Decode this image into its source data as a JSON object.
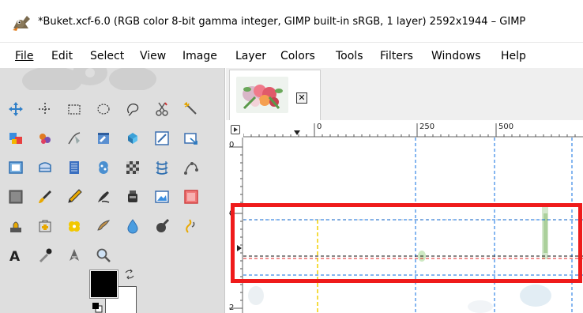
{
  "window": {
    "title": "*Buket.xcf-6.0 (RGB color 8-bit gamma integer, GIMP built-in sRGB, 1 layer) 2592x1944 – GIMP"
  },
  "menubar": {
    "items": [
      {
        "label": "File"
      },
      {
        "label": "Edit"
      },
      {
        "label": "Select"
      },
      {
        "label": "View"
      },
      {
        "label": "Image"
      },
      {
        "label": "Layer"
      },
      {
        "label": "Colors"
      },
      {
        "label": "Tools"
      },
      {
        "label": "Filters"
      },
      {
        "label": "Windows"
      },
      {
        "label": "Help"
      }
    ]
  },
  "toolbox": {
    "tools": [
      "move-icon",
      "alignment-icon",
      "rect-select-icon",
      "ellipse-select-icon",
      "free-select-icon",
      "scissors-select-icon",
      "fuzzy-select-icon",
      "foreground-select-icon",
      "by-color-select-icon",
      "paths-icon",
      "color-picker-icon",
      "zoom-icon",
      "measure-icon",
      "text-tool-icon",
      "crop-icon",
      "unified-transform-icon",
      "perspective-icon",
      "flip-icon",
      "cage-icon",
      "warp-transform-icon",
      "handle-transform-icon",
      "bucket-fill-icon",
      "paintbrush-icon",
      "pencil-icon",
      "ink-icon",
      "airbrush-icon",
      "mypaint-brush-icon",
      "eraser-icon",
      "clone-icon",
      "heal-icon",
      "perspective-clone-icon",
      "smudge-icon",
      "blur-icon",
      "dodge-burn-icon",
      "gradient-icon",
      "text-icon",
      "eyedropper-icon",
      "pen-tool-icon",
      "magnify-icon"
    ],
    "foreground_color": "#000000",
    "background_color": "#ffffff"
  },
  "image_tab": {
    "close_label": "✕"
  },
  "rulers": {
    "horizontal_labels": [
      "0",
      "250",
      "500"
    ],
    "vertical_labels": [
      "0",
      "0",
      "2"
    ]
  },
  "colors": {
    "highlight": "#ef1b1b",
    "guide_blue": "#0b6ee0",
    "guide_yellow": "#f2d000",
    "guide_red": "#e02020"
  }
}
